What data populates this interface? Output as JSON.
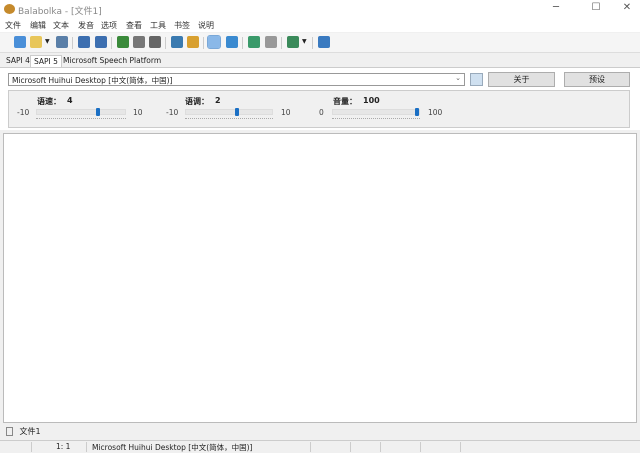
{
  "window": {
    "title": "Balabolka - [文件1]",
    "minimize": "─",
    "maximize": "☐",
    "close": "✕"
  },
  "menu": [
    "文件",
    "编辑",
    "文本",
    "发音",
    "选项",
    "查看",
    "工具",
    "书签",
    "说明"
  ],
  "toolbar": {
    "icons": [
      "new-file-icon",
      "open-folder-icon",
      "dropdown-icon",
      "save-icon",
      "speak-icon",
      "speak-clipboard-icon",
      "play-icon",
      "pause-icon",
      "stop-icon",
      "save-audio-icon",
      "split-icon",
      "active-icon",
      "read-icon",
      "convert-icon",
      "dictionary-icon",
      "voice-icon",
      "dropdown-icon",
      "info-icon"
    ]
  },
  "tabs": [
    "SAPI 4",
    "SAPI 5",
    "Microsoft Speech Platform"
  ],
  "voice": {
    "selected": "Microsoft Huihui Desktop [中文(简体，中国)]",
    "about": "关于",
    "preset": "预设"
  },
  "sliders": [
    {
      "label": "语速：",
      "value": "4",
      "min": "-10",
      "max": "10",
      "fraction": 0.7
    },
    {
      "label": "语调：",
      "value": "2",
      "min": "-10",
      "max": "10",
      "fraction": 0.6
    },
    {
      "label": "音量：",
      "value": "100",
      "min": "0",
      "max": "100",
      "fraction": 1.0
    }
  ],
  "doc_tab": "文件1",
  "status": {
    "position": "1:   1",
    "voice": "Microsoft Huihui Desktop [中文(简体，中国)]"
  }
}
